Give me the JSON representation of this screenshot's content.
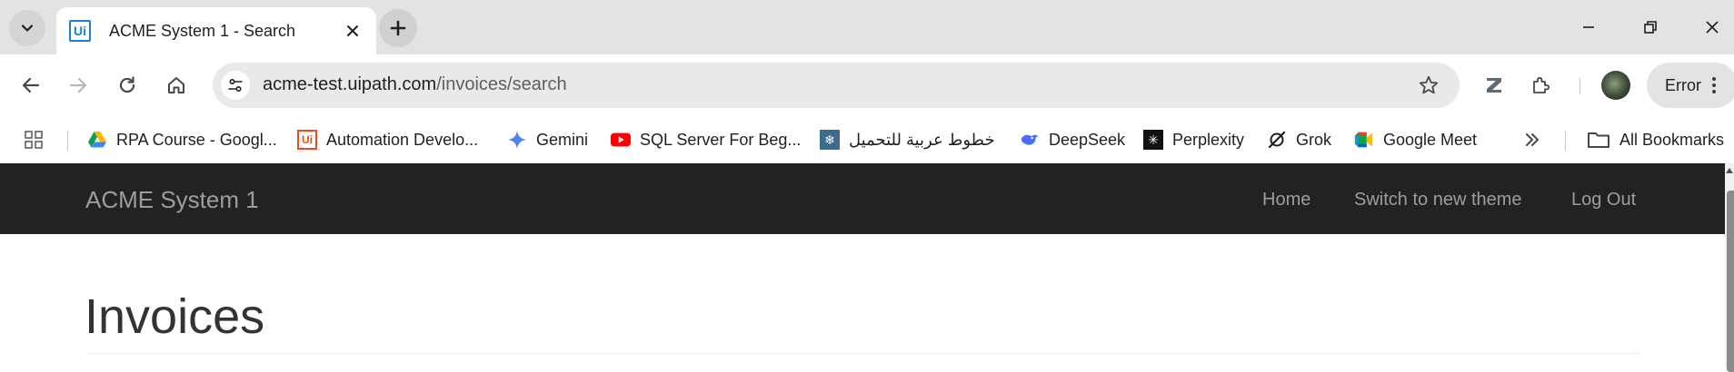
{
  "browser": {
    "tab": {
      "title": "ACME System 1 - Search",
      "favicon_text": "Ui",
      "favicon_icon": "uipath-favicon-icon"
    },
    "window_controls": [
      "minimize-icon",
      "restore-icon",
      "close-icon"
    ],
    "address_bar": {
      "host": "acme-test.uipath.com",
      "path": "/invoices/search"
    },
    "profile_status": "Error",
    "colors": {
      "tab_strip": "#e3e3e3",
      "omnibox": "#e9e9e9",
      "accent": "#1a73e8"
    }
  },
  "bookmarks": {
    "items": [
      {
        "label": "RPA Course - Googl...",
        "icon": "google-drive-icon"
      },
      {
        "label": "Automation Develo...",
        "icon": "uipath-icon"
      },
      {
        "label": "Gemini",
        "icon": "gemini-icon"
      },
      {
        "label": "SQL Server For Beg...",
        "icon": "youtube-icon"
      },
      {
        "label": "خطوط عربية للتحميل",
        "icon": "snowflake-icon"
      },
      {
        "label": "DeepSeek",
        "icon": "deepseek-icon"
      },
      {
        "label": "Perplexity",
        "icon": "perplexity-icon"
      },
      {
        "label": "Grok",
        "icon": "grok-icon"
      },
      {
        "label": "Google Meet",
        "icon": "google-meet-icon"
      }
    ],
    "all_bookmarks_label": "All Bookmarks"
  },
  "app": {
    "brand": "ACME System 1",
    "nav": {
      "home": "Home",
      "theme": "Switch to new theme",
      "logout": "Log Out"
    },
    "page_title": "Invoices",
    "colors": {
      "navbar": "#222222",
      "nav_text": "#9d9d9d",
      "heading": "#333333"
    }
  }
}
